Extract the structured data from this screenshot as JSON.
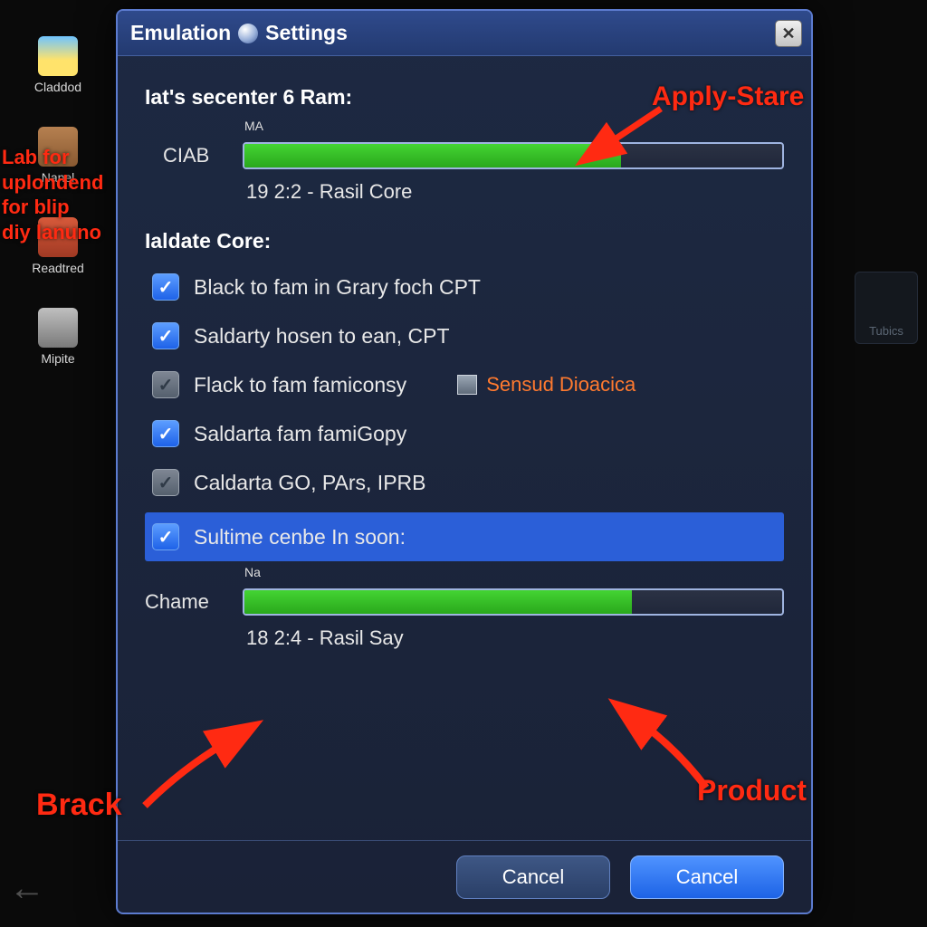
{
  "desktop": {
    "icons": [
      {
        "label": "Claddod"
      },
      {
        "label": "Nanel"
      },
      {
        "label": "Readtred"
      },
      {
        "label": "Mipite"
      }
    ],
    "right_badge": "Tubics"
  },
  "dialog": {
    "title_a": "Emulation",
    "title_b": "Settings",
    "close_glyph": "✕",
    "section1": {
      "heading": "Iat's secenter 6 Ram:",
      "slider_name": "CIAB",
      "slider_mini": "MA",
      "slider_fill_pct": 70,
      "slider_caption": "19 2:2 - Rasil Core"
    },
    "section2": {
      "heading": "Ialdate Core:",
      "items": [
        {
          "checked": true,
          "style": "on",
          "label": "Black to fam in Grary foch CPT"
        },
        {
          "checked": true,
          "style": "on",
          "label": "Saldarty hosen to ean, CPT"
        },
        {
          "checked": true,
          "style": "off",
          "label": "Flack to fam famiconsy"
        },
        {
          "checked": true,
          "style": "on",
          "label": "Saldarta fam famiGopy"
        },
        {
          "checked": true,
          "style": "off",
          "label": "Caldarta GO, PArs, IPRB"
        }
      ],
      "side_option": "Sensud Dioacica",
      "highlight": {
        "label": "Sultime cenbe In soon:",
        "slider_name": "Chame",
        "slider_mini": "Na",
        "slider_fill_pct": 72,
        "slider_caption": "18 2:4 - Rasil Say"
      }
    },
    "buttons": {
      "cancel": "Cancel",
      "ok": "Cancel"
    }
  },
  "annotations": {
    "apply_stare": "Apply-Stare",
    "left_note": "Lab for\nuplondend\nfor blip\ndiy lanuno",
    "brack": "Brack",
    "product": "Product"
  }
}
